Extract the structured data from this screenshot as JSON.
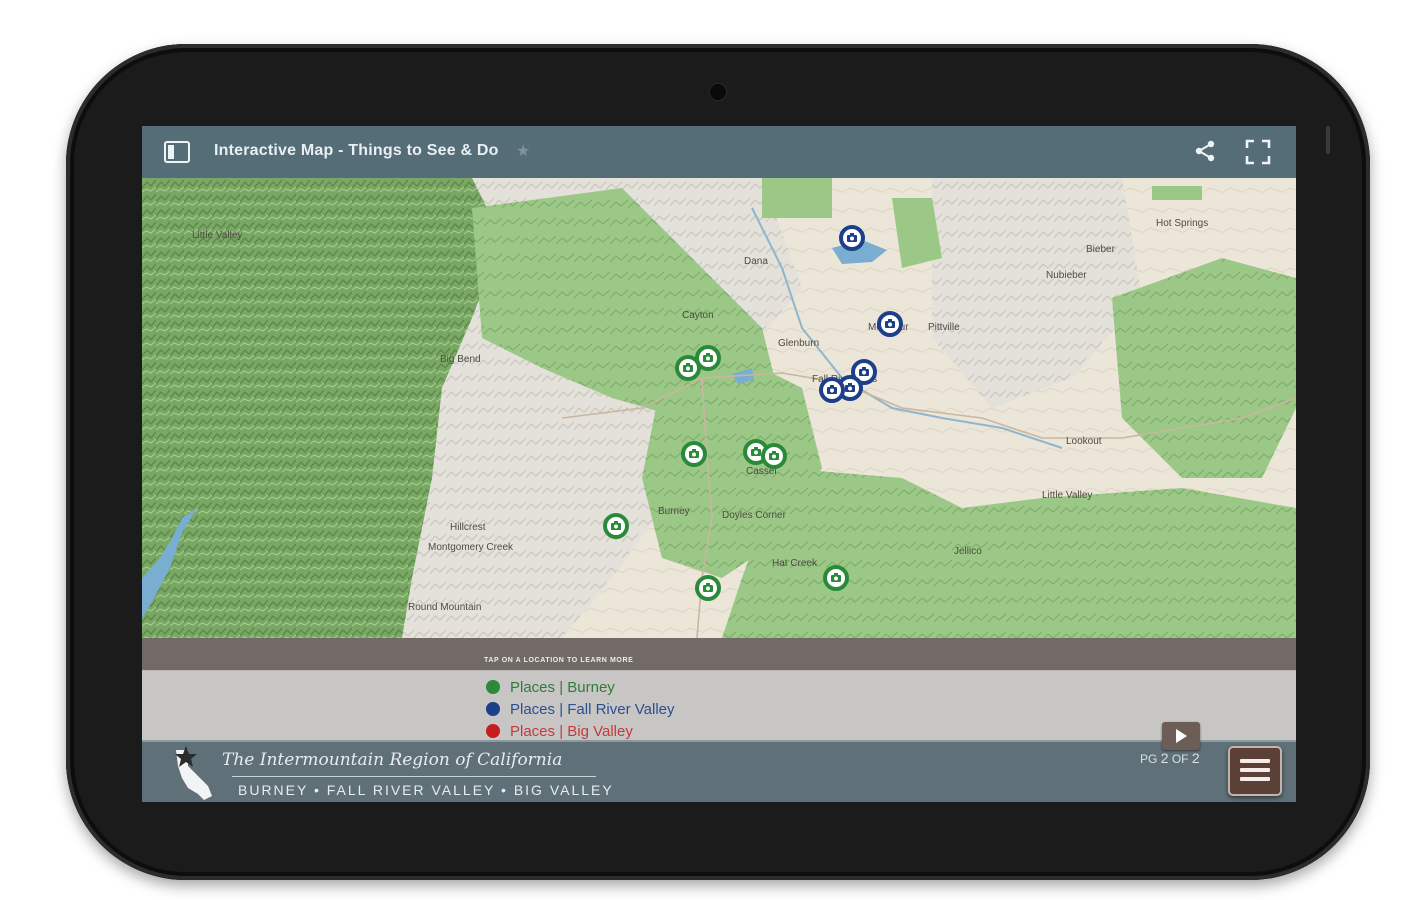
{
  "header": {
    "title": "Interactive Map - Things to See & Do",
    "star": "★"
  },
  "map": {
    "places": [
      {
        "label": "Hot Springs"
      },
      {
        "label": "Bieber"
      },
      {
        "label": "Nubieber"
      },
      {
        "label": "Dana"
      },
      {
        "label": "Cayton"
      },
      {
        "label": "Glenburn"
      },
      {
        "label": "McArthur"
      },
      {
        "label": "Pittville"
      },
      {
        "label": "Fall River Mills"
      },
      {
        "label": "Cassel"
      },
      {
        "label": "Burney"
      },
      {
        "label": "Doyles Corner"
      },
      {
        "label": "Hat Creek"
      },
      {
        "label": "Big Bend"
      },
      {
        "label": "Hillcrest"
      },
      {
        "label": "Montgomery Creek"
      },
      {
        "label": "Round Mountain"
      },
      {
        "label": "Jellico"
      },
      {
        "label": "Little Valley"
      },
      {
        "label": "Lookout"
      },
      {
        "label": "Little Valley"
      }
    ],
    "markers": [
      {
        "region": "Fall River Valley",
        "color": "#1d3f8a"
      },
      {
        "region": "Fall River Valley",
        "color": "#1d3f8a"
      },
      {
        "region": "Fall River Valley",
        "color": "#1d3f8a"
      },
      {
        "region": "Fall River Valley",
        "color": "#1d3f8a"
      },
      {
        "region": "Fall River Valley",
        "color": "#1d3f8a"
      },
      {
        "region": "Burney",
        "color": "#2b8a3a"
      },
      {
        "region": "Burney",
        "color": "#2b8a3a"
      },
      {
        "region": "Burney",
        "color": "#2b8a3a"
      },
      {
        "region": "Burney",
        "color": "#2b8a3a"
      },
      {
        "region": "Burney",
        "color": "#2b8a3a"
      },
      {
        "region": "Burney",
        "color": "#2b8a3a"
      },
      {
        "region": "Burney",
        "color": "#2b8a3a"
      },
      {
        "region": "Burney",
        "color": "#2b8a3a"
      }
    ]
  },
  "info": {
    "hint": "TAP ON A LOCATION TO LEARN MORE"
  },
  "legend": [
    {
      "label": "Places | Burney",
      "color": "#2b8a3a"
    },
    {
      "label": "Places | Fall River Valley",
      "color": "#1d3f8a"
    },
    {
      "label": "Places | Big Valley",
      "color": "#c81d1d"
    }
  ],
  "footer": {
    "brand_script": "The Intermountain Region of California",
    "brand_sub": "BURNEY • FALL RIVER VALLEY • BIG VALLEY",
    "page_prefix": "PG",
    "page_current": "2",
    "page_of": "OF",
    "page_total": "2"
  },
  "colors": {
    "header": "#556d76",
    "footer": "#5f7078",
    "menu_button": "#5b4038",
    "terrain_green": "#8fbf7a",
    "terrain_tan": "#e8e3d6"
  },
  "icons": {
    "panel": "sidebar-toggle-icon",
    "share": "share-icon",
    "fullscreen": "fullscreen-icon",
    "marker": "camera-icon",
    "next": "play-next-icon",
    "menu": "hamburger-menu-icon"
  }
}
